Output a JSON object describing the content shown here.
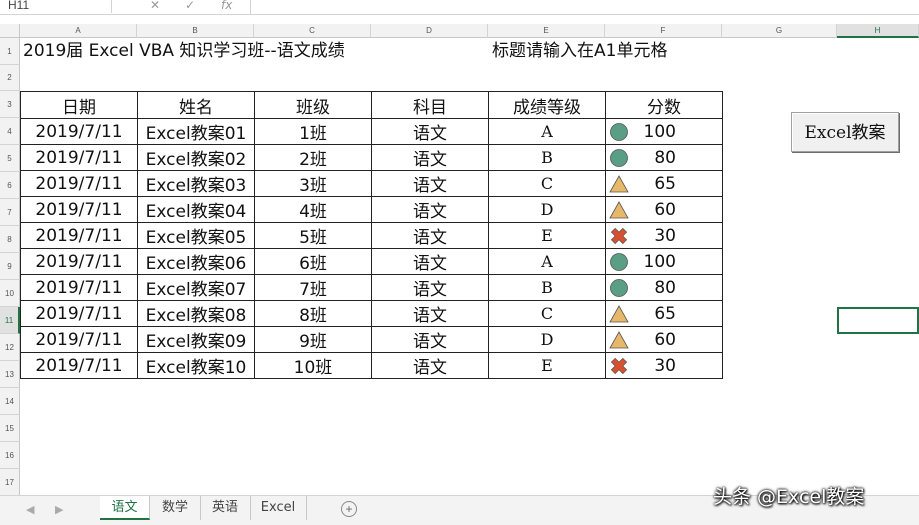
{
  "formula_bar": {
    "name_box": "H11",
    "cancel_icon": "✕",
    "enter_icon": "✓",
    "fx_icon": "fx"
  },
  "columns": [
    "A",
    "B",
    "C",
    "D",
    "E",
    "F",
    "G",
    "H"
  ],
  "rows": [
    "1",
    "2",
    "3",
    "4",
    "5",
    "6",
    "7",
    "8",
    "9",
    "10",
    "11",
    "12",
    "13",
    "14",
    "15",
    "16",
    "17"
  ],
  "sheet": {
    "title": "2019届 Excel VBA 知识学习班--语文成绩",
    "hint": "标题请输入在A1单元格",
    "table": {
      "headers": [
        "日期",
        "姓名",
        "班级",
        "科目",
        "成绩等级",
        "分数"
      ],
      "rows": [
        [
          "2019/7/11",
          "Excel教案01",
          "1班",
          "语文",
          "A",
          "100"
        ],
        [
          "2019/7/11",
          "Excel教案02",
          "2班",
          "语文",
          "B",
          "80"
        ],
        [
          "2019/7/11",
          "Excel教案03",
          "3班",
          "语文",
          "C",
          "65"
        ],
        [
          "2019/7/11",
          "Excel教案04",
          "4班",
          "语文",
          "D",
          "60"
        ],
        [
          "2019/7/11",
          "Excel教案05",
          "5班",
          "语文",
          "E",
          "30"
        ],
        [
          "2019/7/11",
          "Excel教案06",
          "6班",
          "语文",
          "A",
          "100"
        ],
        [
          "2019/7/11",
          "Excel教案07",
          "7班",
          "语文",
          "B",
          "80"
        ],
        [
          "2019/7/11",
          "Excel教案08",
          "8班",
          "语文",
          "C",
          "65"
        ],
        [
          "2019/7/11",
          "Excel教案09",
          "9班",
          "语文",
          "D",
          "60"
        ],
        [
          "2019/7/11",
          "Excel教案10",
          "10班",
          "语文",
          "E",
          "30"
        ]
      ],
      "icons": [
        "circle-green",
        "circle-green",
        "triangle-yellow",
        "triangle-yellow",
        "diamond-red",
        "circle-green",
        "circle-green",
        "triangle-yellow",
        "triangle-yellow",
        "diamond-red"
      ]
    },
    "button_label": "Excel教案",
    "active_cell": "H11"
  },
  "icon_colors": {
    "circle-green": "#5a9e86",
    "triangle-yellow": "#e8b86a",
    "diamond-red": "#d9502e"
  },
  "tabs": [
    {
      "label": "语文",
      "active": true
    },
    {
      "label": "数学",
      "active": false
    },
    {
      "label": "英语",
      "active": false
    },
    {
      "label": "Excel",
      "active": false
    }
  ],
  "add_sheet": "+",
  "watermark": "头条 @Excel教案"
}
